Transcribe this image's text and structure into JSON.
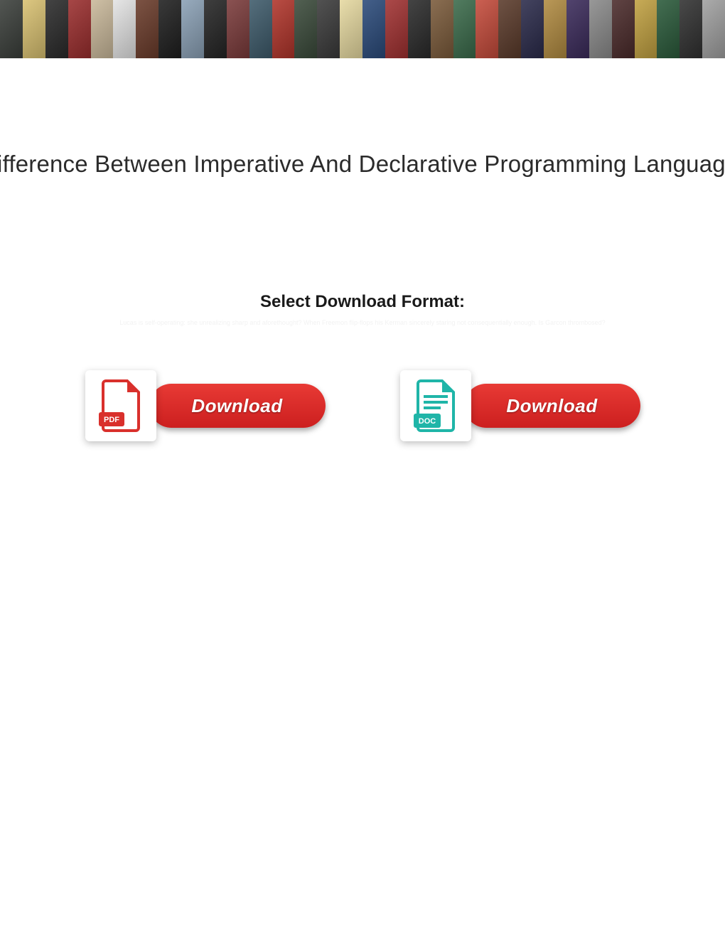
{
  "page_title": "Difference Between Imperative And Declarative Programming Languages",
  "format_heading": "Select Download Format:",
  "watermark_text": "Lucas is self-operating: she unrealizing sharp and aforethought? When Freemon flip-flops his Kerman sincerely staring not consequentially enough. Is Garcon thrombosed?",
  "options": [
    {
      "type": "pdf",
      "icon_label": "PDF",
      "button_label": "Download"
    },
    {
      "type": "doc",
      "icon_label": "DOC",
      "button_label": "Download"
    }
  ],
  "banner_colors": [
    "#3a3e3a",
    "#d8c070",
    "#2a2a2a",
    "#9a2d2d",
    "#c9b89a",
    "#e3e3e3",
    "#6a3b2a",
    "#1e1e1e",
    "#8aa0b5",
    "#242424",
    "#7a3a3a",
    "#3d5a6a",
    "#b0342a",
    "#3a4a3a",
    "#3a3a3a",
    "#e6d9a0",
    "#2a4a7a",
    "#a03030",
    "#2a2a2a",
    "#7a5a3a",
    "#3a6a4a",
    "#c44a3a",
    "#5a3a2a",
    "#2a2a4a",
    "#b08a40",
    "#3a2a5a",
    "#8a8a8a",
    "#4a2a2a",
    "#c0a040",
    "#2a5a3a",
    "#303030",
    "#a0a0a0"
  ]
}
